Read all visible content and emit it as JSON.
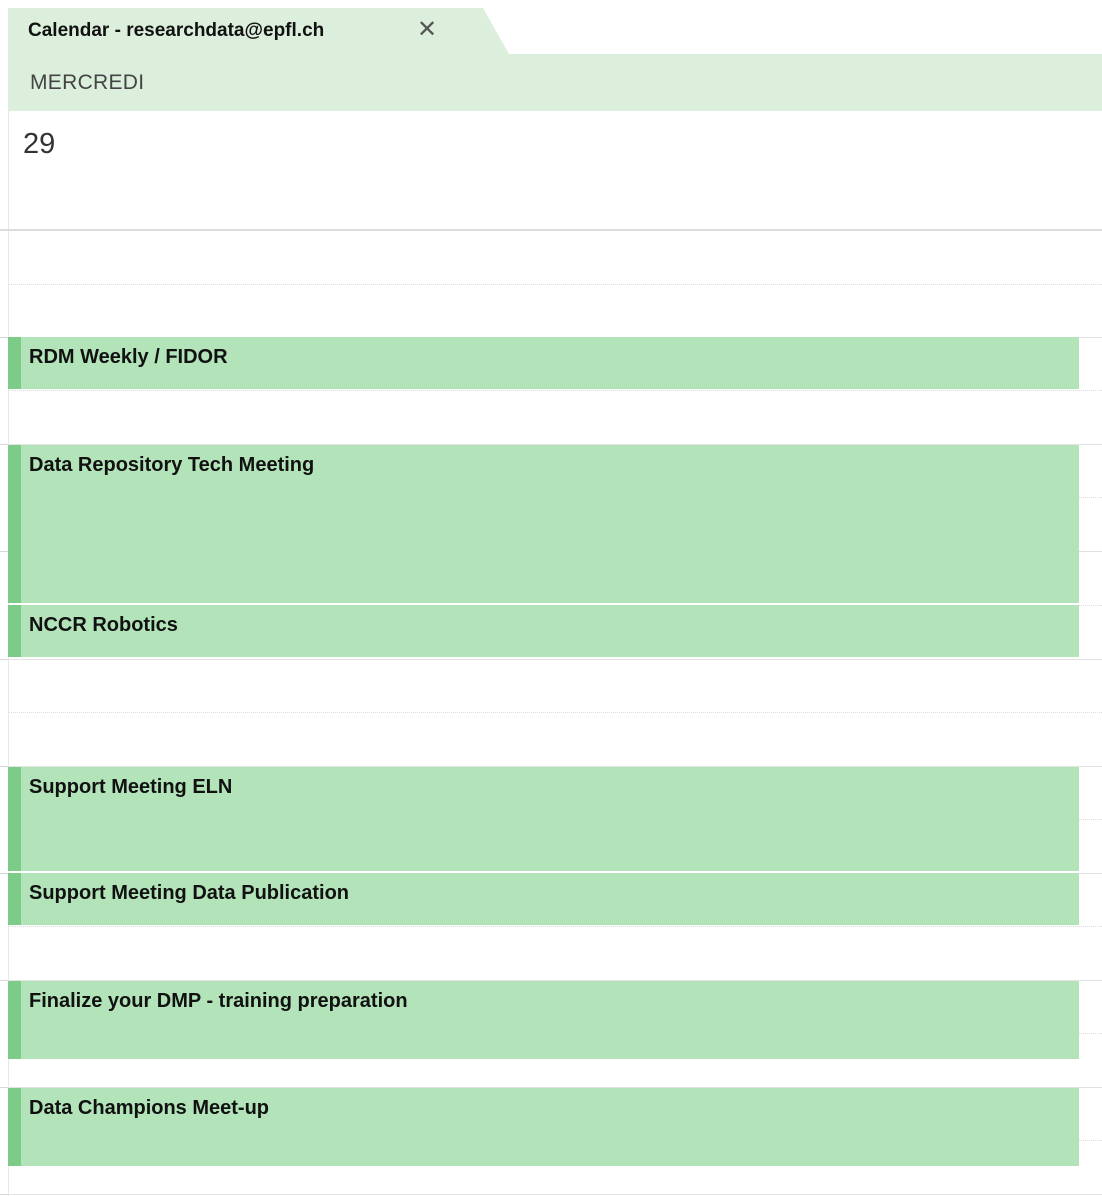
{
  "tab": {
    "title": "Calendar - researchdata@epfl.ch",
    "close_glyph": "✕",
    "close_icon": "close-icon"
  },
  "day": {
    "name": "MERCREDI",
    "number": "29"
  },
  "events": [
    {
      "title": "RDM Weekly / FIDOR"
    },
    {
      "title": "Data Repository Tech Meeting"
    },
    {
      "title": "NCCR Robotics"
    },
    {
      "title": "Support Meeting ELN"
    },
    {
      "title": "Support Meeting Data Publication"
    },
    {
      "title": "Finalize your DMP - training preparation"
    },
    {
      "title": "Data Champions Meet-up"
    }
  ],
  "colors": {
    "header_bg": "#dcefdc",
    "event_bg": "#b2e3b9",
    "event_accent": "#7ccb86"
  }
}
